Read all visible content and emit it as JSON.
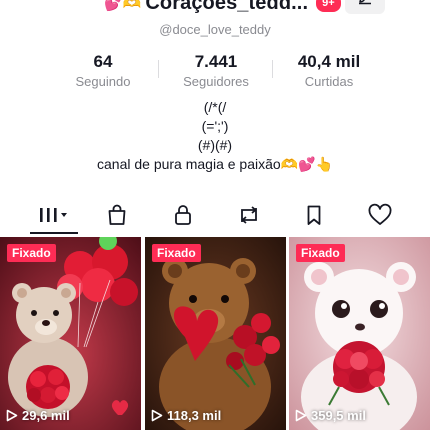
{
  "header": {
    "emoji_left": "💕🫶",
    "name": "Coraçoes_tedd...",
    "badge": "9+",
    "handle": "@doce_love_teddy"
  },
  "stats": [
    {
      "value": "64",
      "label": "Seguindo"
    },
    {
      "value": "7.441",
      "label": "Seguidores"
    },
    {
      "value": "40,4 mil",
      "label": "Curtidas"
    }
  ],
  "bio": {
    "lines": [
      "(/*(/",
      "(=';')",
      "(#)(#)",
      "canal de pura magia e paixão🫶💕👆"
    ]
  },
  "tabs": [
    {
      "name": "videos",
      "icon": "grid-bars-icon"
    },
    {
      "name": "shop",
      "icon": "shopping-bag-icon"
    },
    {
      "name": "private",
      "icon": "lock-icon"
    },
    {
      "name": "reposts",
      "icon": "repost-icon"
    },
    {
      "name": "favorites",
      "icon": "bookmark-icon"
    },
    {
      "name": "liked",
      "icon": "heart-icon"
    }
  ],
  "videos": [
    {
      "pinned_label": "Fixado",
      "views": "29,6 mil"
    },
    {
      "pinned_label": "Fixado",
      "views": "118,3 mil"
    },
    {
      "pinned_label": "Fixado",
      "views": "359,5 mil"
    }
  ],
  "colors": {
    "accent": "#fe2c55",
    "text": "#161823",
    "muted": "#8a8b91"
  }
}
